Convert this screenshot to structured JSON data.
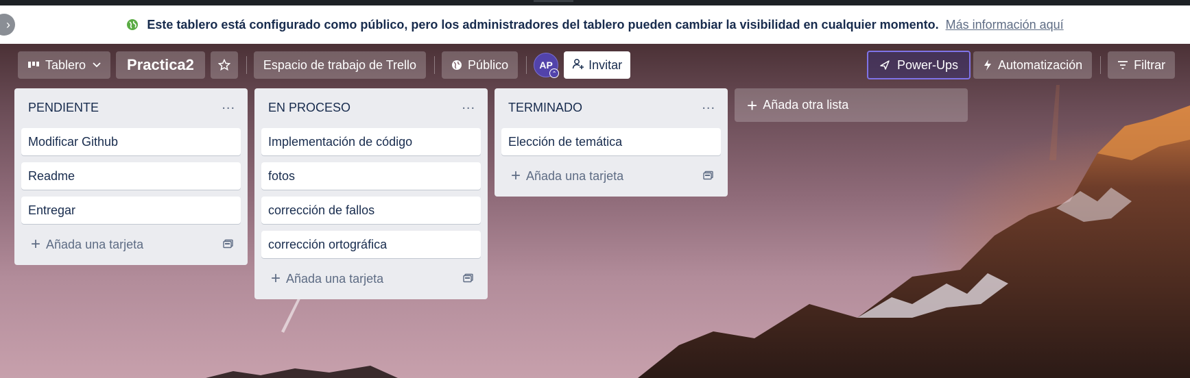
{
  "banner": {
    "message": "Este tablero está configurado como público, pero los administradores del tablero pueden cambiar la visibilidad en cualquier momento.",
    "link": "Más información aquí"
  },
  "board_bar": {
    "view_label": "Tablero",
    "board_title": "Practica2",
    "workspace": "Espacio de trabajo de Trello",
    "visibility": "Público",
    "avatar_initials": "AP",
    "invite": "Invitar",
    "powerups": "Power-Ups",
    "automation": "Automatización",
    "filter": "Filtrar"
  },
  "lists": [
    {
      "title": "PENDIENTE",
      "cards": [
        "Modificar Github",
        "Readme",
        "Entregar"
      ],
      "add_card": "Añada una tarjeta"
    },
    {
      "title": "EN PROCESO",
      "cards": [
        "Implementación de código",
        "fotos",
        "corrección de fallos",
        "corrección ortográfica"
      ],
      "add_card": "Añada una tarjeta"
    },
    {
      "title": "TERMINADO",
      "cards": [
        "Elección de temática"
      ],
      "add_card": "Añada una tarjeta"
    }
  ],
  "add_list": "Añada otra lista",
  "colors": {
    "banner_icon": "#5aac44",
    "list_bg": "#ebecf0",
    "powerups_border": "#7f73e8",
    "avatar": "#5243aa"
  }
}
